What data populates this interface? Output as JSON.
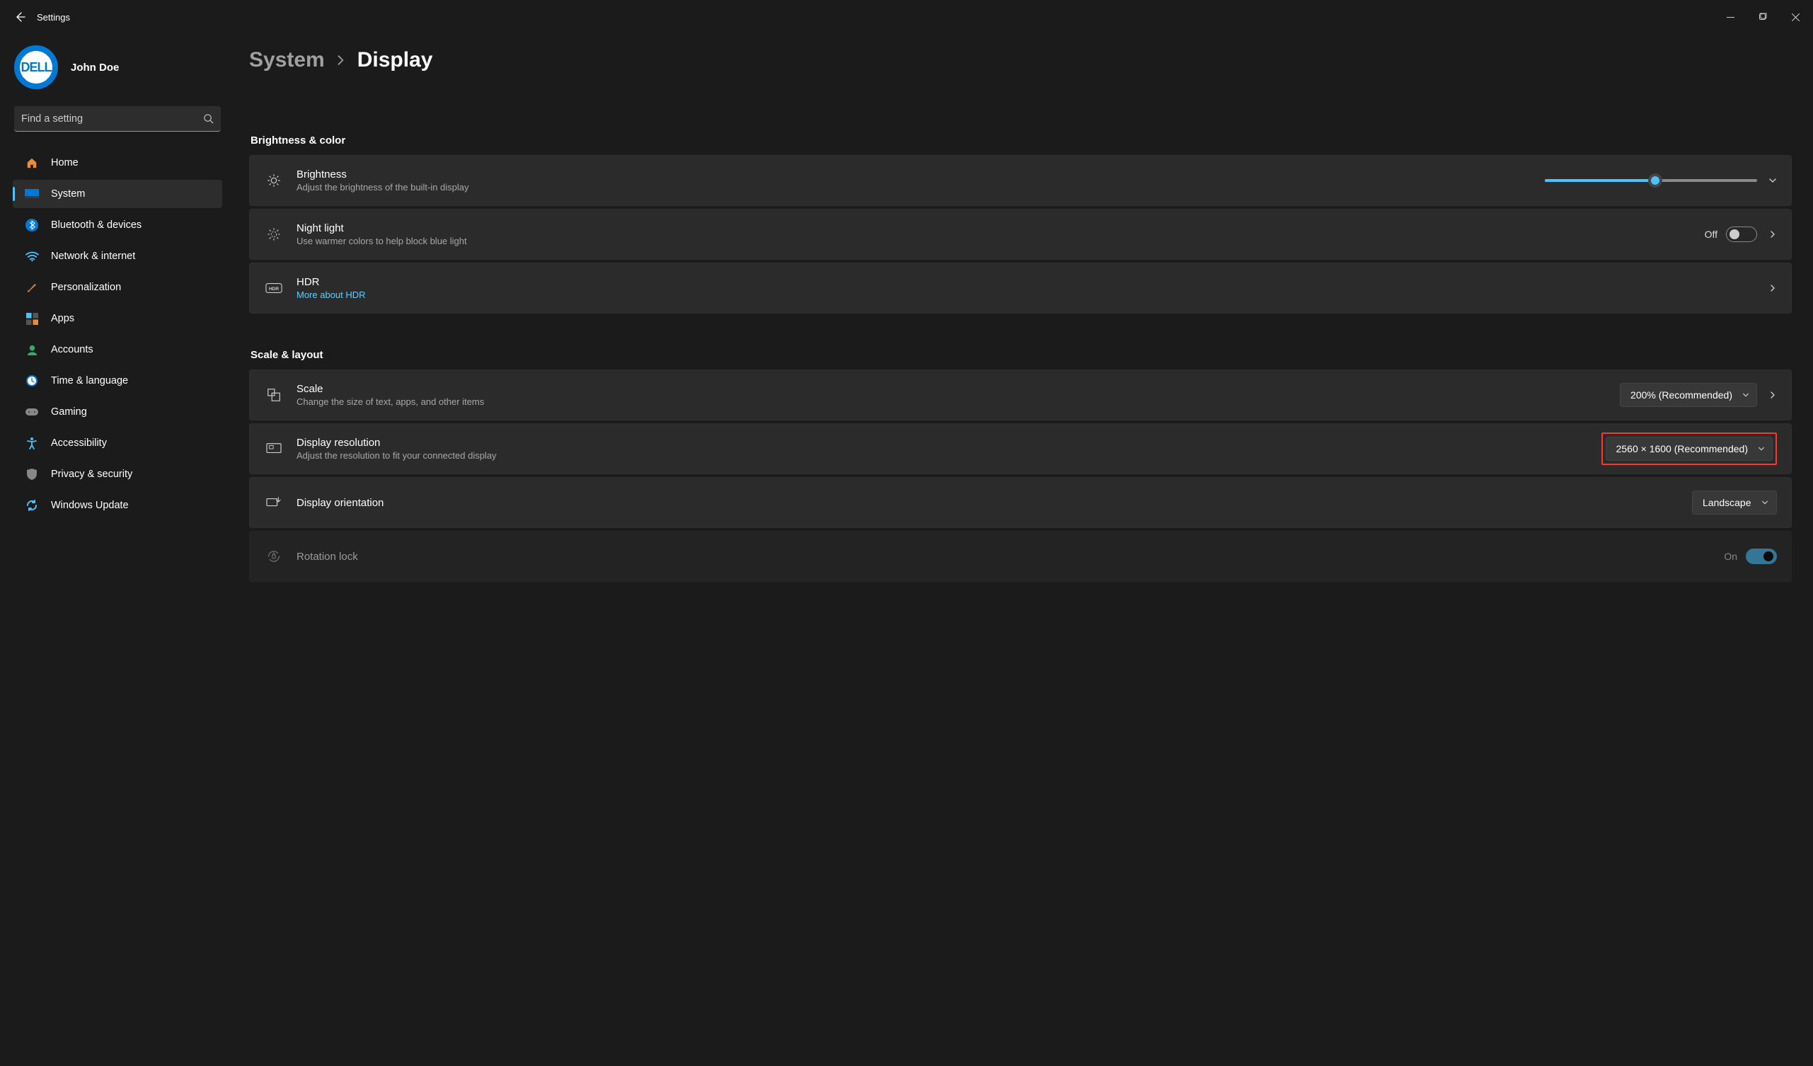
{
  "window": {
    "title": "Settings"
  },
  "user": {
    "name": "John Doe",
    "avatar_text": "DELL"
  },
  "search": {
    "placeholder": "Find a setting"
  },
  "sidebar": {
    "items": [
      {
        "key": "home",
        "label": "Home"
      },
      {
        "key": "system",
        "label": "System",
        "active": true
      },
      {
        "key": "bluetooth",
        "label": "Bluetooth & devices"
      },
      {
        "key": "network",
        "label": "Network & internet"
      },
      {
        "key": "personalization",
        "label": "Personalization"
      },
      {
        "key": "apps",
        "label": "Apps"
      },
      {
        "key": "accounts",
        "label": "Accounts"
      },
      {
        "key": "time",
        "label": "Time & language"
      },
      {
        "key": "gaming",
        "label": "Gaming"
      },
      {
        "key": "accessibility",
        "label": "Accessibility"
      },
      {
        "key": "privacy",
        "label": "Privacy & security"
      },
      {
        "key": "update",
        "label": "Windows Update"
      }
    ]
  },
  "breadcrumb": {
    "parent": "System",
    "current": "Display"
  },
  "sections": {
    "brightness_color_header": "Brightness & color",
    "scale_layout_header": "Scale & layout"
  },
  "brightness": {
    "title": "Brightness",
    "sub": "Adjust the brightness of the built-in display",
    "value_percent": 52
  },
  "night_light": {
    "title": "Night light",
    "sub": "Use warmer colors to help block blue light",
    "state_label": "Off",
    "on": false
  },
  "hdr": {
    "title": "HDR",
    "link": "More about HDR"
  },
  "scale": {
    "title": "Scale",
    "sub": "Change the size of text, apps, and other items",
    "value": "200% (Recommended)"
  },
  "resolution": {
    "title": "Display resolution",
    "sub": "Adjust the resolution to fit your connected display",
    "value": "2560 × 1600 (Recommended)"
  },
  "orientation": {
    "title": "Display orientation",
    "value": "Landscape"
  },
  "rotation_lock": {
    "title": "Rotation lock",
    "state_label": "On",
    "on": true,
    "disabled": true
  }
}
